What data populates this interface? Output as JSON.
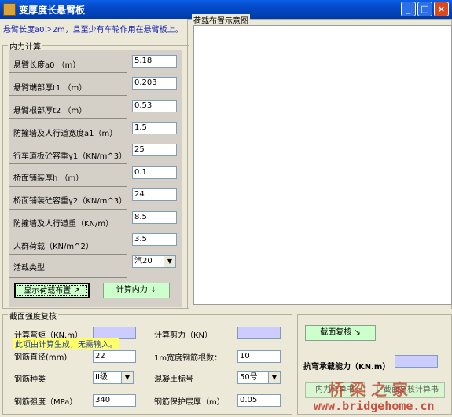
{
  "window": {
    "title": "变厚度长悬臂板",
    "min": "_",
    "max": "□",
    "close": "×"
  },
  "hint": "悬臂长度a0＞2m，且至少有车轮作用在悬臂板上。",
  "internal": {
    "group_label": "内力计算",
    "fields": [
      {
        "label": "悬臂长度a0  （m）",
        "value": "5.18"
      },
      {
        "label": "悬臂端部厚t1 （m）",
        "value": "0.203"
      },
      {
        "label": "悬臂根部厚t2 （m）",
        "value": "0.53"
      },
      {
        "label": "防撞墙及人行道宽度a1（m）",
        "value": "1.5"
      },
      {
        "label": "行车道板砼容重γ1（KN/m^3）",
        "value": "25"
      },
      {
        "label": "桥面铺装厚h （m）",
        "value": "0.1"
      },
      {
        "label": "桥面铺装砼容重γ2（KN/m^3）",
        "value": "24"
      },
      {
        "label": "防撞墙及人行道重（KN/m）",
        "value": "8.5"
      },
      {
        "label": "人群荷载（KN/m^2）",
        "value": "3.5"
      }
    ],
    "live_load_label": "活载类型",
    "live_load_value": "汽20",
    "show_load_button": "显示荷载布置 ↗",
    "calc_button": "计算内力 ↓"
  },
  "diagram": {
    "group_label": "荷载布置示意图"
  },
  "section": {
    "group_label": "截面强度复核",
    "moment_label": "计算弯矩（KN.m）",
    "shear_label": "计算剪力（KN）",
    "note": "此项由计算生成，无需输入。",
    "diameter_label": "钢筋直径(mm)",
    "diameter_value": "22",
    "count_label": "1m宽度钢筋根数：",
    "count_value": "10",
    "steel_type_label": "钢筋种类",
    "steel_type_value": "II级",
    "concrete_label": "混凝土标号",
    "concrete_value": "50号",
    "strength_label": "钢筋强度（MPa）",
    "strength_value": "340",
    "cover_label": "钢筋保护层厚（m）",
    "cover_value": "0.05"
  },
  "review": {
    "button": "截面复核 ↘",
    "capacity_label": "抗弯承载能力（KN.m）",
    "btn_a": "内力计算书",
    "btn_b": "截面复核计算书"
  },
  "watermark": {
    "line1": "桥 梁 之 家",
    "line2": "www.bridgehome.cn"
  }
}
